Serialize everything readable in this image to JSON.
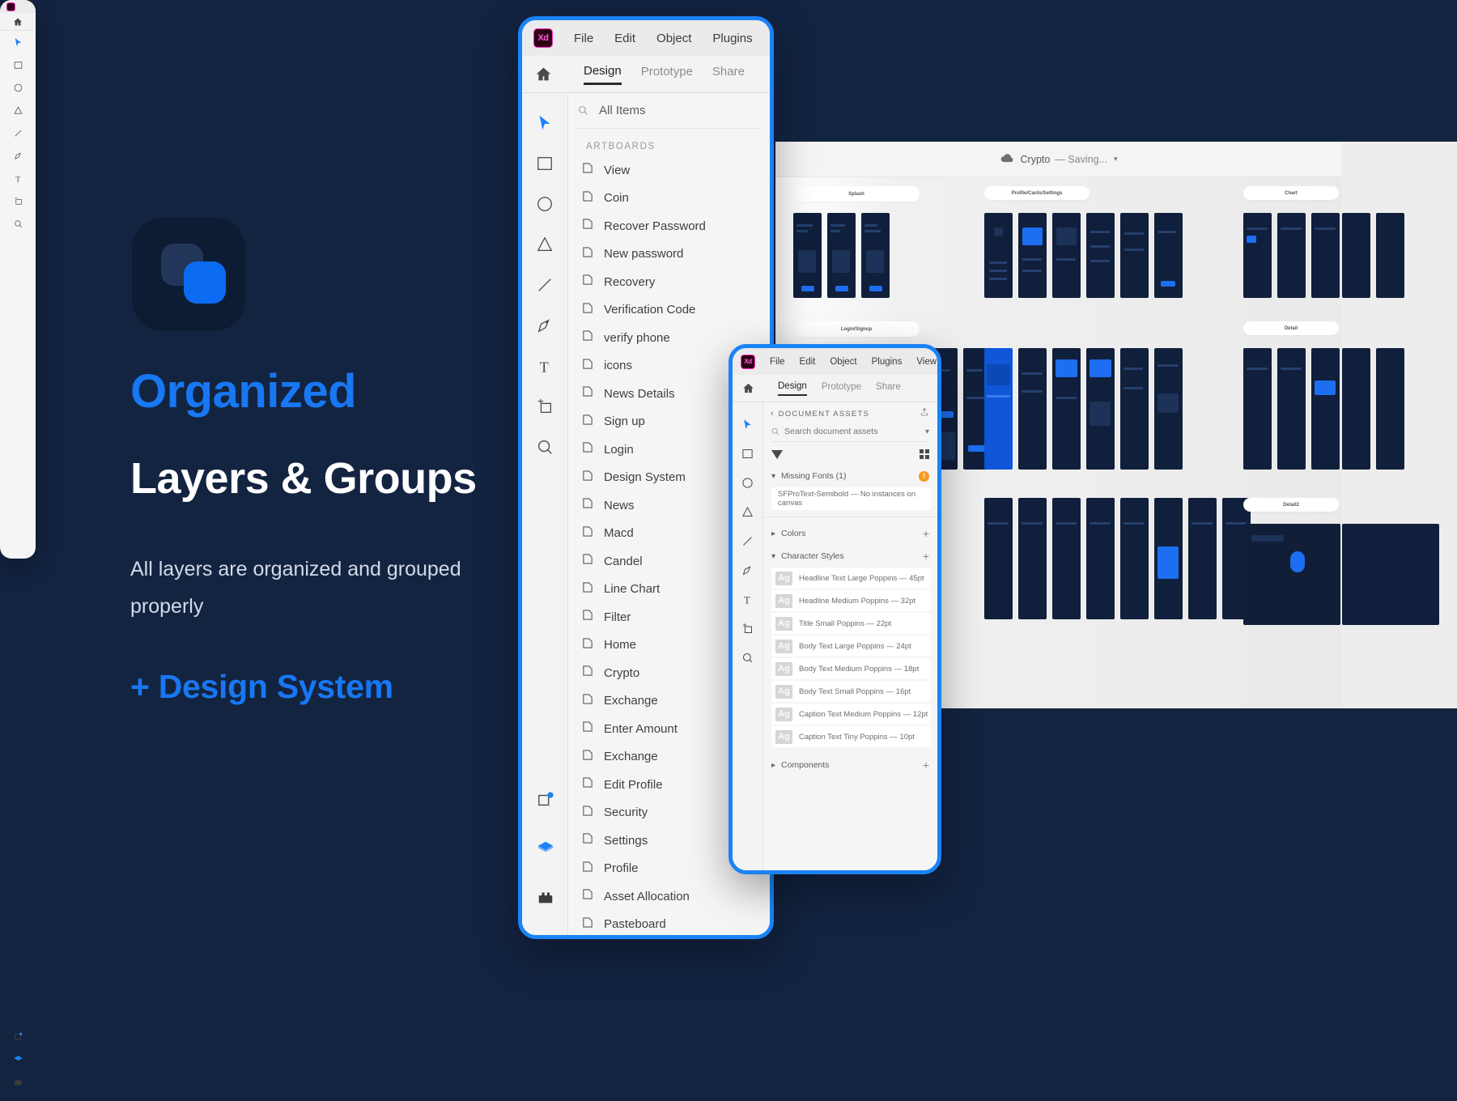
{
  "marketing": {
    "logo_alt": "app-logo",
    "headline_top": "Organized",
    "headline_bottom": "Layers & Groups",
    "sub_copy": "All layers are organized and grouped properly",
    "design_system_line": "+ Design System",
    "accent_blue": "#1877f2",
    "background": "#132441"
  },
  "layers_window": {
    "app_badge": "Xd",
    "menu": [
      "File",
      "Edit",
      "Object",
      "Plugins"
    ],
    "tabs": [
      {
        "label": "Design",
        "active": true
      },
      {
        "label": "Prototype",
        "active": false
      },
      {
        "label": "Share",
        "active": false
      }
    ],
    "search_value": "All Items",
    "section_title": "ARTBOARDS",
    "artboards": [
      "View",
      "Coin",
      "Recover Password",
      "New password",
      "Recovery",
      "Verification Code",
      "verify phone",
      "icons",
      "News Details",
      "Sign up",
      "Login",
      "Design System",
      "News",
      "Macd",
      "Candel",
      "Line Chart",
      "Filter",
      "Home",
      "Crypto",
      "Exchange",
      "Enter Amount",
      "Exchange",
      "Edit Profile",
      "Security",
      "Settings",
      "Profile",
      "Asset Allocation",
      "Pasteboard"
    ],
    "tools": [
      "select-tool",
      "rectangle-tool",
      "ellipse-tool",
      "polygon-tool",
      "line-tool",
      "pen-tool",
      "text-tool",
      "artboard-tool",
      "zoom-tool"
    ],
    "bottom_tools": [
      "components-library",
      "layers-panel",
      "plugins-panel"
    ]
  },
  "assets_window": {
    "app_badge": "Xd",
    "menu": [
      "File",
      "Edit",
      "Object",
      "Plugins",
      "View"
    ],
    "tabs": [
      {
        "label": "Design",
        "active": true
      },
      {
        "label": "Prototype",
        "active": false
      },
      {
        "label": "Share",
        "active": false
      }
    ],
    "panel_title": "DOCUMENT ASSETS",
    "search_placeholder": "Search document assets",
    "groups": {
      "missing_fonts": {
        "label": "Missing Fonts (1)",
        "badge": "!",
        "badge_color": "#f59b1d",
        "items": [
          "SFProText-Semibold — No instances on canvas"
        ]
      },
      "colors": {
        "label": "Colors",
        "expanded": false
      },
      "character_styles": {
        "label": "Character Styles",
        "expanded": true,
        "items": [
          "Headline Text Large Poppins — 45pt",
          "Headline Medium Poppins — 32pt",
          "Title Small Poppins — 22pt",
          "Body Text Large Poppins — 24pt",
          "Body Text Medium Poppins — 18pt",
          "Body Text Small Poppins — 16pt",
          "Caption Text Medium Poppins — 12pt",
          "Caption Text Tiny Poppins — 10pt"
        ],
        "chip_label": "Ag"
      },
      "components": {
        "label": "Components",
        "expanded": false
      }
    }
  },
  "canvas": {
    "document_title": "Crypto",
    "save_status": "— Saving...",
    "artboard_group_labels": [
      "Splash",
      "Login/Signup",
      "Profile/Cards/Settings",
      "Chart",
      "Detail",
      "Detail2"
    ]
  }
}
